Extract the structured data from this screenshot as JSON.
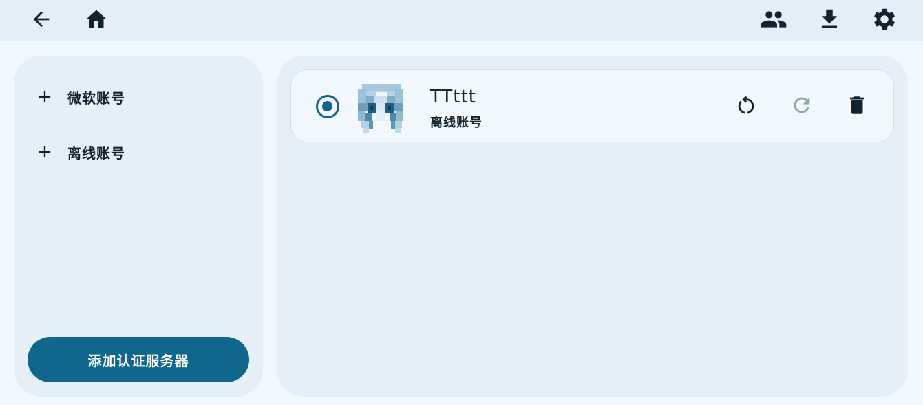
{
  "toolbar": {
    "left_icons": [
      "back-arrow-icon",
      "home-icon"
    ],
    "right_icons": [
      "people-icon",
      "download-icon",
      "gear-icon"
    ]
  },
  "sidebar": {
    "items": [
      {
        "label": "微软账号",
        "icon": "plus-icon"
      },
      {
        "label": "离线账号",
        "icon": "plus-icon"
      }
    ],
    "add_server_label": "添加认证服务器"
  },
  "accounts": [
    {
      "name": "TTttt",
      "type": "离线账号",
      "selected": true,
      "actions": [
        "refresh-skin-icon",
        "reload-icon",
        "delete-icon"
      ]
    }
  ],
  "colors": {
    "accent": "#10678b",
    "topbar_bg": "#e5eef7",
    "panel_bg": "#e6eef6",
    "card_bg": "#f3f8fd",
    "icon_dark": "#14222e",
    "icon_disabled": "#8fa2b0"
  }
}
